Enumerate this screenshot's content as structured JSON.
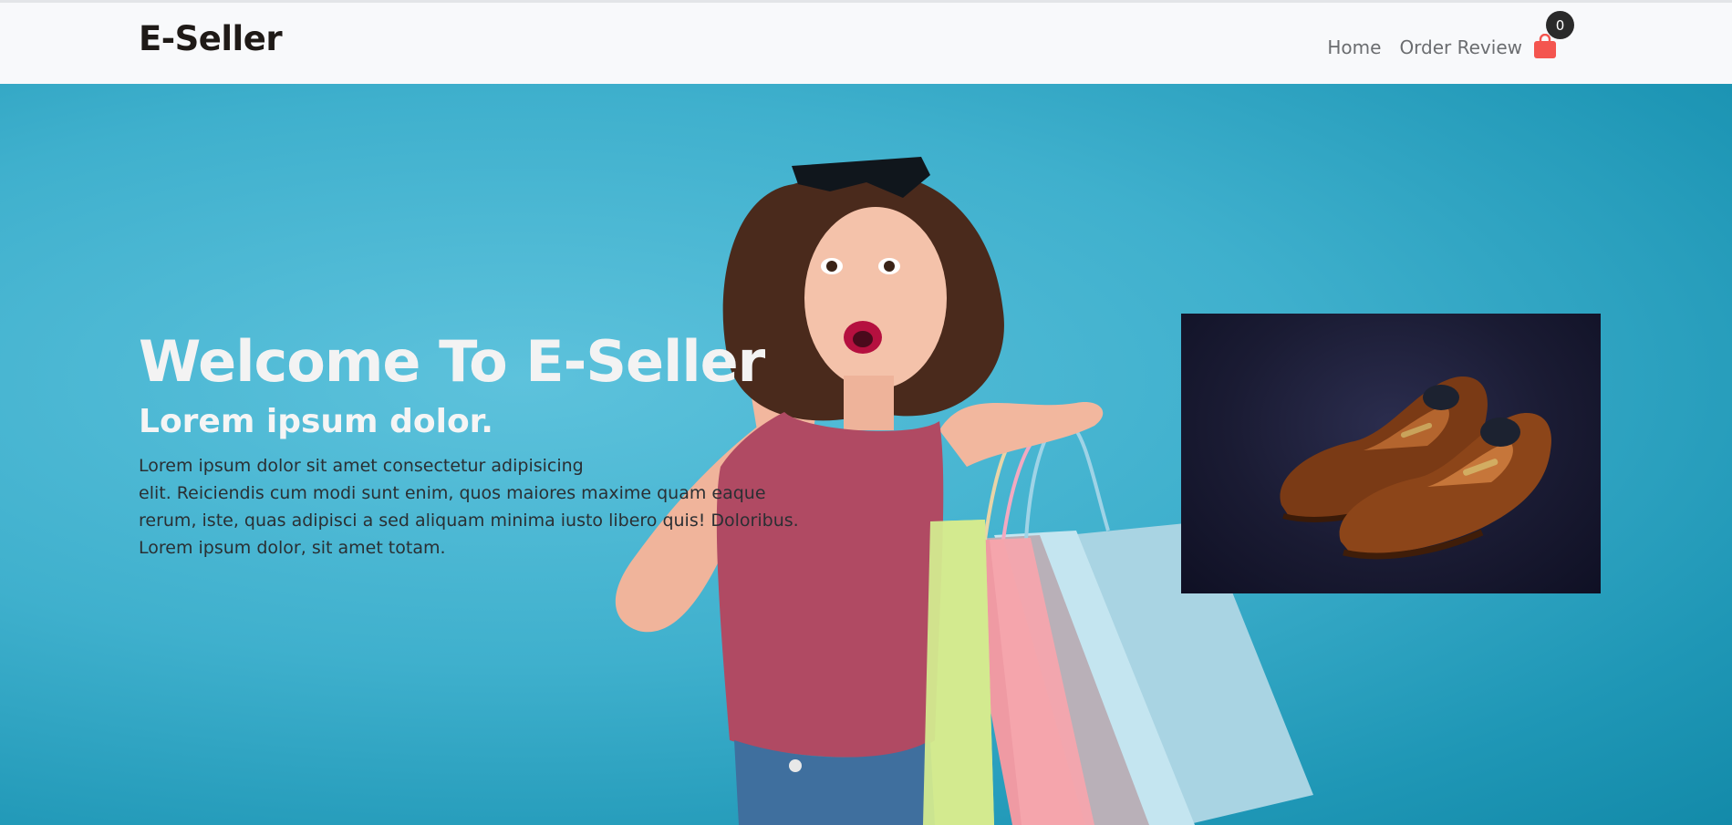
{
  "nav": {
    "brand": "E-Seller",
    "links": [
      "Home",
      "Order Review"
    ],
    "cart_count": "0",
    "cart_icon": "shopping-bag-icon",
    "cart_color": "#f4554f"
  },
  "hero": {
    "title": "Welcome To E-Seller",
    "subtitle": "Lorem ipsum dolor.",
    "text_lines": [
      "Lorem ipsum dolor sit amet consectetur adipisicing",
      "elit. Reiciendis cum modi sunt enim, quos maiores maxime quam eaque",
      "rerum, iste, quas adipisci a sed aliquam minima iusto libero quis! Doloribus.",
      "Lorem ipsum dolor, sit amet totam."
    ],
    "background_color": "#3fb0cd"
  },
  "product": {
    "image": "brown-loafer-shoes"
  }
}
